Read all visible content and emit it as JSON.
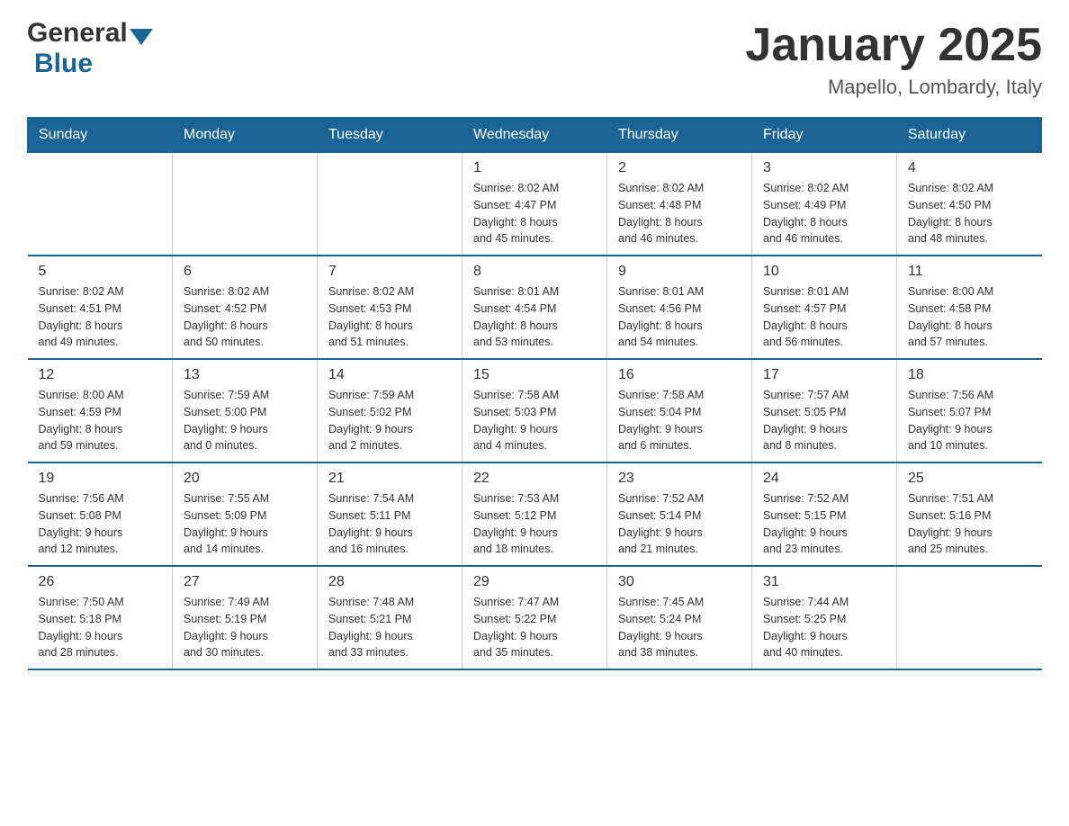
{
  "logo": {
    "general": "General",
    "blue": "Blue"
  },
  "title": "January 2025",
  "subtitle": "Mapello, Lombardy, Italy",
  "days_of_week": [
    "Sunday",
    "Monday",
    "Tuesday",
    "Wednesday",
    "Thursday",
    "Friday",
    "Saturday"
  ],
  "weeks": [
    [
      {
        "num": "",
        "info": ""
      },
      {
        "num": "",
        "info": ""
      },
      {
        "num": "",
        "info": ""
      },
      {
        "num": "1",
        "info": "Sunrise: 8:02 AM\nSunset: 4:47 PM\nDaylight: 8 hours\nand 45 minutes."
      },
      {
        "num": "2",
        "info": "Sunrise: 8:02 AM\nSunset: 4:48 PM\nDaylight: 8 hours\nand 46 minutes."
      },
      {
        "num": "3",
        "info": "Sunrise: 8:02 AM\nSunset: 4:49 PM\nDaylight: 8 hours\nand 46 minutes."
      },
      {
        "num": "4",
        "info": "Sunrise: 8:02 AM\nSunset: 4:50 PM\nDaylight: 8 hours\nand 48 minutes."
      }
    ],
    [
      {
        "num": "5",
        "info": "Sunrise: 8:02 AM\nSunset: 4:51 PM\nDaylight: 8 hours\nand 49 minutes."
      },
      {
        "num": "6",
        "info": "Sunrise: 8:02 AM\nSunset: 4:52 PM\nDaylight: 8 hours\nand 50 minutes."
      },
      {
        "num": "7",
        "info": "Sunrise: 8:02 AM\nSunset: 4:53 PM\nDaylight: 8 hours\nand 51 minutes."
      },
      {
        "num": "8",
        "info": "Sunrise: 8:01 AM\nSunset: 4:54 PM\nDaylight: 8 hours\nand 53 minutes."
      },
      {
        "num": "9",
        "info": "Sunrise: 8:01 AM\nSunset: 4:56 PM\nDaylight: 8 hours\nand 54 minutes."
      },
      {
        "num": "10",
        "info": "Sunrise: 8:01 AM\nSunset: 4:57 PM\nDaylight: 8 hours\nand 56 minutes."
      },
      {
        "num": "11",
        "info": "Sunrise: 8:00 AM\nSunset: 4:58 PM\nDaylight: 8 hours\nand 57 minutes."
      }
    ],
    [
      {
        "num": "12",
        "info": "Sunrise: 8:00 AM\nSunset: 4:59 PM\nDaylight: 8 hours\nand 59 minutes."
      },
      {
        "num": "13",
        "info": "Sunrise: 7:59 AM\nSunset: 5:00 PM\nDaylight: 9 hours\nand 0 minutes."
      },
      {
        "num": "14",
        "info": "Sunrise: 7:59 AM\nSunset: 5:02 PM\nDaylight: 9 hours\nand 2 minutes."
      },
      {
        "num": "15",
        "info": "Sunrise: 7:58 AM\nSunset: 5:03 PM\nDaylight: 9 hours\nand 4 minutes."
      },
      {
        "num": "16",
        "info": "Sunrise: 7:58 AM\nSunset: 5:04 PM\nDaylight: 9 hours\nand 6 minutes."
      },
      {
        "num": "17",
        "info": "Sunrise: 7:57 AM\nSunset: 5:05 PM\nDaylight: 9 hours\nand 8 minutes."
      },
      {
        "num": "18",
        "info": "Sunrise: 7:56 AM\nSunset: 5:07 PM\nDaylight: 9 hours\nand 10 minutes."
      }
    ],
    [
      {
        "num": "19",
        "info": "Sunrise: 7:56 AM\nSunset: 5:08 PM\nDaylight: 9 hours\nand 12 minutes."
      },
      {
        "num": "20",
        "info": "Sunrise: 7:55 AM\nSunset: 5:09 PM\nDaylight: 9 hours\nand 14 minutes."
      },
      {
        "num": "21",
        "info": "Sunrise: 7:54 AM\nSunset: 5:11 PM\nDaylight: 9 hours\nand 16 minutes."
      },
      {
        "num": "22",
        "info": "Sunrise: 7:53 AM\nSunset: 5:12 PM\nDaylight: 9 hours\nand 18 minutes."
      },
      {
        "num": "23",
        "info": "Sunrise: 7:52 AM\nSunset: 5:14 PM\nDaylight: 9 hours\nand 21 minutes."
      },
      {
        "num": "24",
        "info": "Sunrise: 7:52 AM\nSunset: 5:15 PM\nDaylight: 9 hours\nand 23 minutes."
      },
      {
        "num": "25",
        "info": "Sunrise: 7:51 AM\nSunset: 5:16 PM\nDaylight: 9 hours\nand 25 minutes."
      }
    ],
    [
      {
        "num": "26",
        "info": "Sunrise: 7:50 AM\nSunset: 5:18 PM\nDaylight: 9 hours\nand 28 minutes."
      },
      {
        "num": "27",
        "info": "Sunrise: 7:49 AM\nSunset: 5:19 PM\nDaylight: 9 hours\nand 30 minutes."
      },
      {
        "num": "28",
        "info": "Sunrise: 7:48 AM\nSunset: 5:21 PM\nDaylight: 9 hours\nand 33 minutes."
      },
      {
        "num": "29",
        "info": "Sunrise: 7:47 AM\nSunset: 5:22 PM\nDaylight: 9 hours\nand 35 minutes."
      },
      {
        "num": "30",
        "info": "Sunrise: 7:45 AM\nSunset: 5:24 PM\nDaylight: 9 hours\nand 38 minutes."
      },
      {
        "num": "31",
        "info": "Sunrise: 7:44 AM\nSunset: 5:25 PM\nDaylight: 9 hours\nand 40 minutes."
      },
      {
        "num": "",
        "info": ""
      }
    ]
  ]
}
